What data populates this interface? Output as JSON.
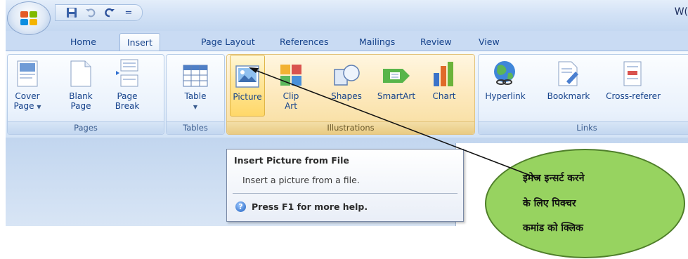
{
  "titlebar": {
    "app_title": "W(",
    "qat": [
      "save-icon",
      "undo-icon",
      "redo-icon",
      "customize-icon"
    ],
    "qat_glyph_customize": "="
  },
  "tabs": [
    {
      "label": "Home"
    },
    {
      "label": "Insert",
      "active": true
    },
    {
      "label": "Page Layout"
    },
    {
      "label": "References"
    },
    {
      "label": "Mailings"
    },
    {
      "label": "Review"
    },
    {
      "label": "View"
    }
  ],
  "ribbon": {
    "groups": {
      "pages": {
        "label": "Pages",
        "buttons": [
          {
            "label_line1": "Cover",
            "label_line2": "Page",
            "dropdown": "▼",
            "icon": "cover-page-icon"
          },
          {
            "label_line1": "Blank",
            "label_line2": "Page",
            "icon": "blank-page-icon"
          },
          {
            "label_line1": "Page",
            "label_line2": "Break",
            "icon": "page-break-icon"
          }
        ]
      },
      "tables": {
        "label": "Tables",
        "buttons": [
          {
            "label_line1": "Table",
            "dropdown": "▼",
            "icon": "table-icon"
          }
        ]
      },
      "illustrations": {
        "label": "Illustrations",
        "buttons": [
          {
            "label_line1": "Picture",
            "icon": "picture-icon",
            "hovered": true
          },
          {
            "label_line1": "Clip",
            "label_line2": "Art",
            "icon": "clip-art-icon"
          },
          {
            "label_line1": "Shapes",
            "icon": "shapes-icon"
          },
          {
            "label_line1": "SmartArt",
            "icon": "smartart-icon"
          },
          {
            "label_line1": "Chart",
            "icon": "chart-icon"
          }
        ]
      },
      "links": {
        "label": "Links",
        "buttons": [
          {
            "label_line1": "Hyperlink",
            "icon": "hyperlink-icon"
          },
          {
            "label_line1": "Bookmark",
            "icon": "bookmark-icon"
          },
          {
            "label_line1": "Cross-referer",
            "icon": "cross-reference-icon"
          }
        ]
      }
    }
  },
  "tooltip": {
    "title": "Insert Picture from File",
    "description": "Insert a picture from a file.",
    "help": "Press F1 for more help.",
    "help_glyph": "?"
  },
  "callout": {
    "line1": "इमेज इन्सर्ट करने",
    "line2": "के लिए पिक्चर",
    "line3": "कमांड को क्लिक"
  },
  "colors": {
    "accent_text": "#15428b",
    "hover_fill": "#ffd869",
    "callout_fill": "#97d360"
  }
}
